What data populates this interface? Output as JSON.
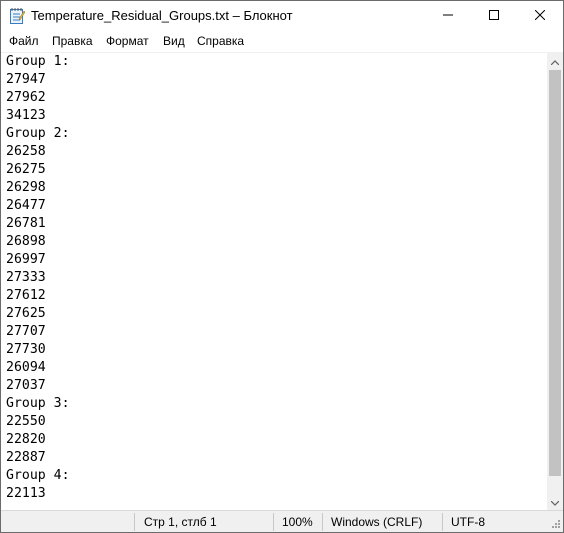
{
  "window": {
    "title": "Temperature_Residual_Groups.txt – Блокнот",
    "app_icon": "notepad-icon",
    "controls": {
      "minimize_icon": "minimize-icon",
      "maximize_icon": "maximize-icon",
      "close_icon": "close-icon"
    }
  },
  "menu": {
    "items": [
      "Файл",
      "Правка",
      "Формат",
      "Вид",
      "Справка"
    ]
  },
  "editor": {
    "lines": [
      "Group 1:",
      "27947",
      "27962",
      "34123",
      "Group 2:",
      "26258",
      "26275",
      "26298",
      "26477",
      "26781",
      "26898",
      "26997",
      "27333",
      "27612",
      "27625",
      "27707",
      "27730",
      "26094",
      "27037",
      "Group 3:",
      "22550",
      "22820",
      "22887",
      "Group 4:",
      "22113"
    ]
  },
  "scrollbar": {
    "up_icon": "scroll-up-arrow-icon",
    "down_icon": "scroll-down-arrow-icon"
  },
  "statusbar": {
    "position": "Стр 1, стлб 1",
    "zoom": "100%",
    "line_endings": "Windows (CRLF)",
    "encoding": "UTF-8"
  },
  "colors": {
    "thumb": "#c2c2c2",
    "statusbar_bg": "#f0f0f0",
    "border": "#6b6b6b"
  }
}
